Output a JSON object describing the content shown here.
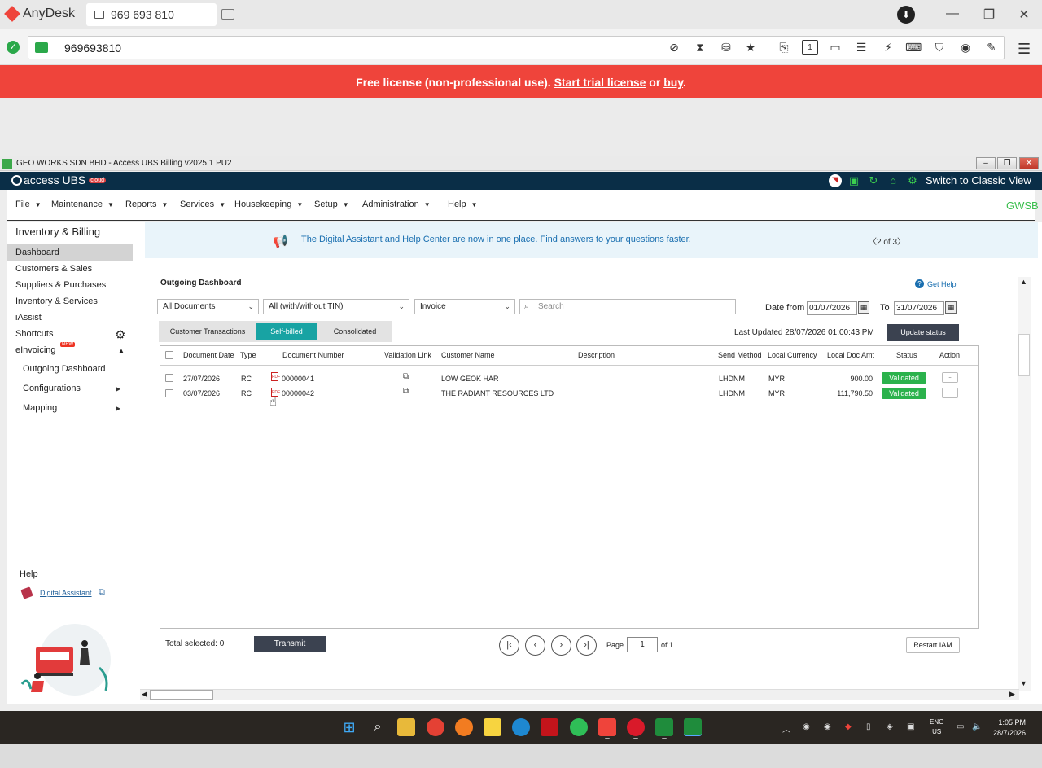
{
  "anydesk": {
    "app_name": "AnyDesk",
    "tab_label": "969 693 810",
    "address": "969693810",
    "banner_prefix": "Free license (non-professional use). ",
    "banner_link1": "Start trial license",
    "banner_mid": " or ",
    "banner_link2": "buy",
    "banner_suffix": ".",
    "win_min": "—",
    "win_restore": "❐",
    "win_close": "✕"
  },
  "window": {
    "title": "GEO WORKS SDN BHD - Access UBS Billing v2025.1 PU2"
  },
  "ubs": {
    "logo_text": "access UBS",
    "cloud_badge": "cloud",
    "classic_view": "Switch to Classic View",
    "company_code": "GWSB"
  },
  "menu": [
    "File",
    "Maintenance",
    "Reports",
    "Services",
    "Housekeeping",
    "Setup",
    "Administration",
    "Help"
  ],
  "sidebar": {
    "title": "Inventory & Billing",
    "items": [
      "Dashboard",
      "Customers & Sales",
      "Suppliers & Purchases",
      "Inventory & Services",
      "iAssist",
      "Shortcuts",
      "eInvoicing"
    ],
    "new_badge": "NEW",
    "sub_items": [
      "Outgoing Dashboard",
      "Configurations",
      "Mapping"
    ],
    "help_title": "Help",
    "digital_assistant": "Digital Assistant"
  },
  "assist_banner": {
    "text": "The Digital Assistant and Help Center are now in one place.  Find answers to your questions faster.",
    "pager": "2 of 3"
  },
  "dashboard": {
    "title": "Outgoing Dashboard",
    "get_help": "Get Help",
    "filter_docs": "All Documents",
    "filter_tin": "All (with/without TIN)",
    "filter_type": "Invoice",
    "search_placeholder": "Search",
    "date_from_label": "Date from",
    "date_from": "01/07/2026",
    "date_to_label": "To",
    "date_to": "31/07/2026",
    "tabs": [
      "Customer Transactions",
      "Self-billed",
      "Consolidated"
    ],
    "last_updated": "Last Updated 28/07/2026 01:00:43 PM",
    "update_status": "Update status",
    "columns": [
      "Document Date",
      "Type",
      "Document Number",
      "Validation Link",
      "Customer Name",
      "Description",
      "Send Method",
      "Local Currency",
      "Local Doc Amt",
      "Status",
      "Action"
    ],
    "rows": [
      {
        "date": "27/07/2026",
        "type": "RC",
        "doc_no": "00000041",
        "customer": "LOW GEOK HAR",
        "description": "",
        "send_method": "LHDNM",
        "currency": "MYR",
        "amount": "900.00",
        "status": "Validated",
        "action": "..."
      },
      {
        "date": "03/07/2026",
        "type": "RC",
        "doc_no": "00000042",
        "customer": "THE RADIANT RESOURCES LTD",
        "description": "",
        "send_method": "LHDNM",
        "currency": "MYR",
        "amount": "111,790.50",
        "status": "Validated",
        "action": "..."
      }
    ],
    "total_selected": "Total selected:  0",
    "transmit": "Transmit",
    "page_label": "Page",
    "page_value": "1",
    "page_of": "of 1",
    "restart": "Restart IAM"
  },
  "taskbar": {
    "lang": "ENG",
    "region": "US",
    "time": "1:05 PM",
    "date": "28/7/2026"
  },
  "colors": {
    "anydesk_red": "#ef443b",
    "ubs_navy": "#0a2e47",
    "accent_green": "#3cbf4f",
    "teal_tab": "#18a3a3",
    "validated_green": "#2bb24c",
    "dark_button": "#3b4250"
  }
}
